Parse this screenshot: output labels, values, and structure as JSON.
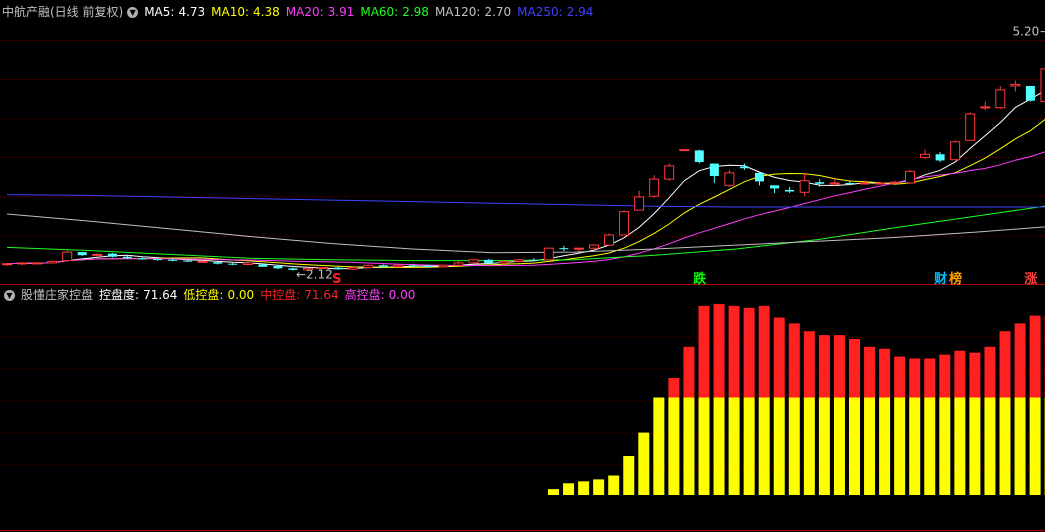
{
  "main_header": {
    "title": "中航产融(日线 前复权)",
    "items": [
      {
        "label": "MA5:",
        "value": "4.73",
        "color": "#ffffff"
      },
      {
        "label": "MA10:",
        "value": "4.38",
        "color": "#ffff00"
      },
      {
        "label": "MA20:",
        "value": "3.91",
        "color": "#ff40ff"
      },
      {
        "label": "MA60:",
        "value": "2.98",
        "color": "#20ff20"
      },
      {
        "label": "MA120:",
        "value": "2.70",
        "color": "#c0c0c0"
      },
      {
        "label": "MA250:",
        "value": "2.94",
        "color": "#4040ff"
      }
    ]
  },
  "sub_header": {
    "title": "股懂庄家控盘",
    "items": [
      {
        "label": "控盘度:",
        "value": "71.64",
        "color": "#ffffff"
      },
      {
        "label": "低控盘:",
        "value": "0.00",
        "color": "#ffff00"
      },
      {
        "label": "中控盘:",
        "value": "71.64",
        "color": "#ff2020"
      },
      {
        "label": "高控盘:",
        "value": "0.00",
        "color": "#ff40ff"
      }
    ]
  },
  "chart_data": [
    {
      "type": "candlestick",
      "stock": "中航产融",
      "period": "日线 前复权",
      "ylim": [
        2.0,
        5.35
      ],
      "high_label": "5.20",
      "low_label": "2.12",
      "candles": [
        [
          2.2,
          2.22,
          2.18,
          2.21
        ],
        [
          2.21,
          2.23,
          2.19,
          2.22
        ],
        [
          2.22,
          2.23,
          2.2,
          2.22
        ],
        [
          2.22,
          2.25,
          2.21,
          2.24
        ],
        [
          2.25,
          2.38,
          2.24,
          2.36
        ],
        [
          2.36,
          2.36,
          2.31,
          2.32
        ],
        [
          2.32,
          2.34,
          2.3,
          2.33
        ],
        [
          2.34,
          2.35,
          2.29,
          2.3
        ],
        [
          2.3,
          2.31,
          2.27,
          2.28
        ],
        [
          2.28,
          2.29,
          2.26,
          2.27
        ],
        [
          2.27,
          2.28,
          2.25,
          2.26
        ],
        [
          2.26,
          2.27,
          2.24,
          2.25
        ],
        [
          2.25,
          2.26,
          2.23,
          2.24
        ],
        [
          2.24,
          2.25,
          2.22,
          2.24
        ],
        [
          2.23,
          2.24,
          2.2,
          2.21
        ],
        [
          2.21,
          2.22,
          2.19,
          2.2
        ],
        [
          2.2,
          2.23,
          2.19,
          2.22
        ],
        [
          2.2,
          2.21,
          2.17,
          2.17
        ],
        [
          2.18,
          2.19,
          2.14,
          2.15
        ],
        [
          2.15,
          2.16,
          2.12,
          2.13
        ],
        [
          2.13,
          2.16,
          2.12,
          2.15
        ],
        [
          2.15,
          2.17,
          2.14,
          2.16
        ],
        [
          2.16,
          2.17,
          2.13,
          2.14
        ],
        [
          2.14,
          2.16,
          2.13,
          2.16
        ],
        [
          2.16,
          2.2,
          2.15,
          2.19
        ],
        [
          2.19,
          2.2,
          2.16,
          2.17
        ],
        [
          2.17,
          2.2,
          2.16,
          2.19
        ],
        [
          2.19,
          2.21,
          2.17,
          2.18
        ],
        [
          2.18,
          2.2,
          2.16,
          2.17
        ],
        [
          2.17,
          2.2,
          2.16,
          2.19
        ],
        [
          2.19,
          2.24,
          2.18,
          2.22
        ],
        [
          2.22,
          2.27,
          2.21,
          2.26
        ],
        [
          2.26,
          2.27,
          2.21,
          2.22
        ],
        [
          2.22,
          2.25,
          2.2,
          2.24
        ],
        [
          2.24,
          2.27,
          2.23,
          2.26
        ],
        [
          2.26,
          2.28,
          2.24,
          2.25
        ],
        [
          2.26,
          2.42,
          2.26,
          2.41
        ],
        [
          2.41,
          2.44,
          2.37,
          2.4
        ],
        [
          2.4,
          2.42,
          2.37,
          2.41
        ],
        [
          2.41,
          2.46,
          2.39,
          2.45
        ],
        [
          2.45,
          2.6,
          2.44,
          2.58
        ],
        [
          2.58,
          2.9,
          2.58,
          2.88
        ],
        [
          2.9,
          3.15,
          2.9,
          3.07
        ],
        [
          3.08,
          3.35,
          3.06,
          3.3
        ],
        [
          3.3,
          3.5,
          3.28,
          3.47
        ],
        [
          3.68,
          3.68,
          3.66,
          3.68
        ],
        [
          3.67,
          3.68,
          3.5,
          3.52
        ],
        [
          3.5,
          3.5,
          3.25,
          3.34
        ],
        [
          3.22,
          3.42,
          3.2,
          3.38
        ],
        [
          3.46,
          3.5,
          3.42,
          3.44
        ],
        [
          3.38,
          3.4,
          3.22,
          3.27
        ],
        [
          3.22,
          3.22,
          3.12,
          3.18
        ],
        [
          3.16,
          3.2,
          3.12,
          3.14
        ],
        [
          3.13,
          3.38,
          3.08,
          3.28
        ],
        [
          3.26,
          3.3,
          3.2,
          3.24
        ],
        [
          3.24,
          3.3,
          3.21,
          3.25
        ],
        [
          3.25,
          3.28,
          3.22,
          3.24
        ],
        [
          3.24,
          3.28,
          3.23,
          3.25
        ],
        [
          3.25,
          3.26,
          3.24,
          3.25
        ],
        [
          3.26,
          3.28,
          3.25,
          3.26
        ],
        [
          3.25,
          3.42,
          3.25,
          3.4
        ],
        [
          3.58,
          3.68,
          3.56,
          3.62
        ],
        [
          3.62,
          3.65,
          3.52,
          3.54
        ],
        [
          3.55,
          3.8,
          3.55,
          3.78
        ],
        [
          3.8,
          4.16,
          3.79,
          4.14
        ],
        [
          4.23,
          4.3,
          4.19,
          4.23
        ],
        [
          4.22,
          4.5,
          4.2,
          4.45
        ],
        [
          4.5,
          4.57,
          4.43,
          4.52
        ],
        [
          4.5,
          4.5,
          4.3,
          4.31
        ],
        [
          4.3,
          4.74,
          4.24,
          4.72
        ],
        [
          4.9,
          5.2,
          4.62,
          4.7
        ]
      ],
      "moving_averages": [
        {
          "name": "MA5",
          "color": "#ffffff"
        },
        {
          "name": "MA10",
          "color": "#ffff00"
        },
        {
          "name": "MA20",
          "color": "#ff40ff"
        },
        {
          "name": "MA60",
          "color": "#20ff20",
          "values": [
            2.42,
            2.38,
            2.33,
            2.28,
            2.26,
            2.25,
            2.25,
            2.26,
            2.32,
            2.4,
            2.52,
            2.68,
            2.83,
            2.98
          ]
        },
        {
          "name": "MA120",
          "color": "#c0c0c0",
          "values": [
            2.85,
            2.76,
            2.66,
            2.56,
            2.47,
            2.4,
            2.35,
            2.36,
            2.4,
            2.45,
            2.5,
            2.55,
            2.62,
            2.7
          ]
        },
        {
          "name": "MA250",
          "color": "#4040ff",
          "values": [
            3.1,
            3.09,
            3.07,
            3.05,
            3.03,
            3.01,
            2.99,
            2.97,
            2.95,
            2.94,
            2.94,
            2.94,
            2.94,
            2.94
          ]
        }
      ],
      "markers": [
        {
          "text": "跌",
          "index": 46,
          "color": "#00ff00"
        },
        {
          "text": "财",
          "index": 62,
          "color": "#00c0ff"
        },
        {
          "text": "榜",
          "index": 63,
          "color": "#ffa000"
        },
        {
          "text": "涨",
          "index": 68,
          "color": "#ff4040"
        },
        {
          "text": "S",
          "index": 22,
          "color": "#ff2020"
        }
      ]
    },
    {
      "type": "bar",
      "title": "股懂庄家控盘",
      "ylim": [
        0,
        100
      ],
      "series": [
        {
          "name": "低控盘",
          "color": "#ffff00",
          "values": [
            3,
            6,
            7,
            8,
            10,
            20,
            32,
            50,
            50,
            50,
            50,
            50,
            50,
            50,
            50,
            50,
            50,
            50,
            50,
            50,
            50,
            50,
            50,
            50,
            50,
            50,
            50,
            50,
            50,
            50,
            50,
            50,
            50,
            50,
            50,
            50
          ]
        },
        {
          "name": "中控盘",
          "color": "#ff2020",
          "values": [
            0,
            0,
            0,
            0,
            0,
            0,
            0,
            0,
            10,
            26,
            47,
            48,
            47,
            46,
            47,
            41,
            38,
            34,
            32,
            32,
            30,
            26,
            25,
            21,
            20,
            20,
            22,
            24,
            23,
            26,
            34,
            38,
            42,
            42,
            42,
            47
          ]
        }
      ]
    }
  ]
}
